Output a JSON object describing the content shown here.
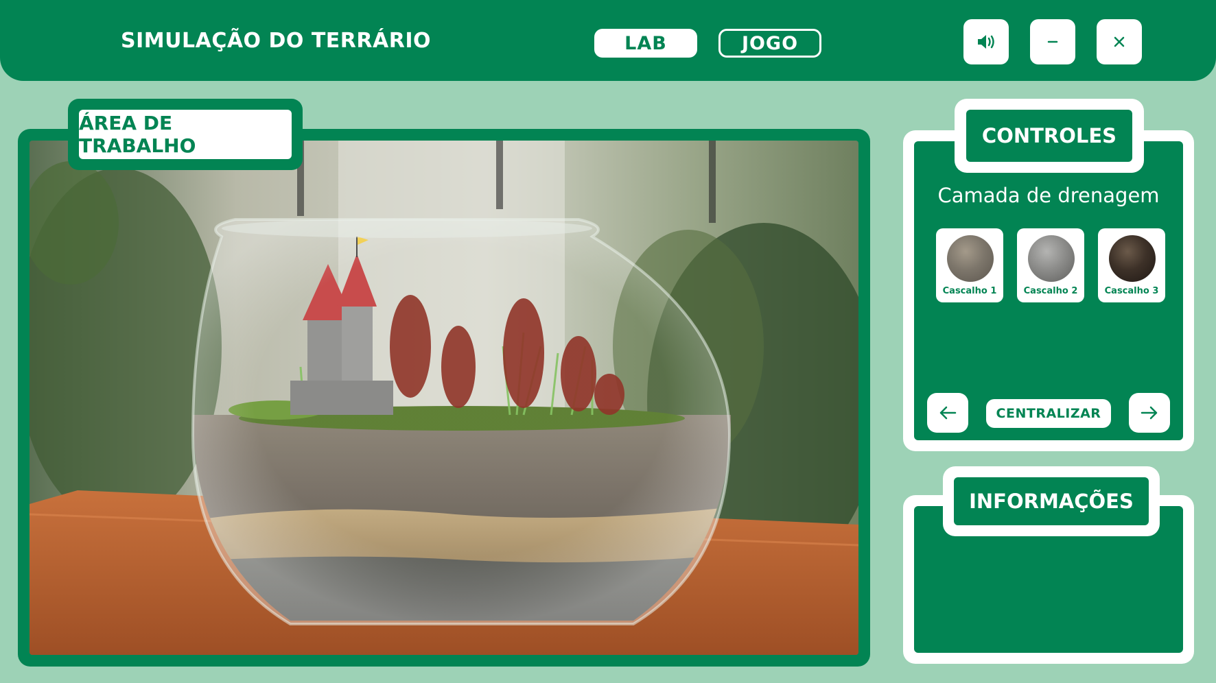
{
  "header": {
    "title": "SIMULAÇÃO DO TERRÁRIO",
    "modes": [
      {
        "label": "LAB",
        "selected": true
      },
      {
        "label": "JOGO",
        "selected": false
      }
    ],
    "window_controls": {
      "sound_icon": "speaker-icon",
      "minimize_icon": "minus-icon",
      "close_icon": "close-icon"
    }
  },
  "workspace": {
    "tab_label": "ÁREA DE TRABALHO",
    "scene": "terrarium-scene"
  },
  "controls": {
    "tab_label": "CONTROLES",
    "layer_title": "Camada de drenagem",
    "options": [
      {
        "label": "Cascalho 1",
        "color": "#7d766b"
      },
      {
        "label": "Cascalho 2",
        "color": "#8c8c8a"
      },
      {
        "label": "Cascalho 3",
        "color": "#3d3128"
      }
    ],
    "prev_icon": "arrow-left-icon",
    "next_icon": "arrow-right-icon",
    "center_label": "CENTRALIZAR"
  },
  "info": {
    "tab_label": "INFORMAÇÕES"
  },
  "colors": {
    "primary": "#028453",
    "background": "#9dd2b6",
    "white": "#ffffff"
  }
}
